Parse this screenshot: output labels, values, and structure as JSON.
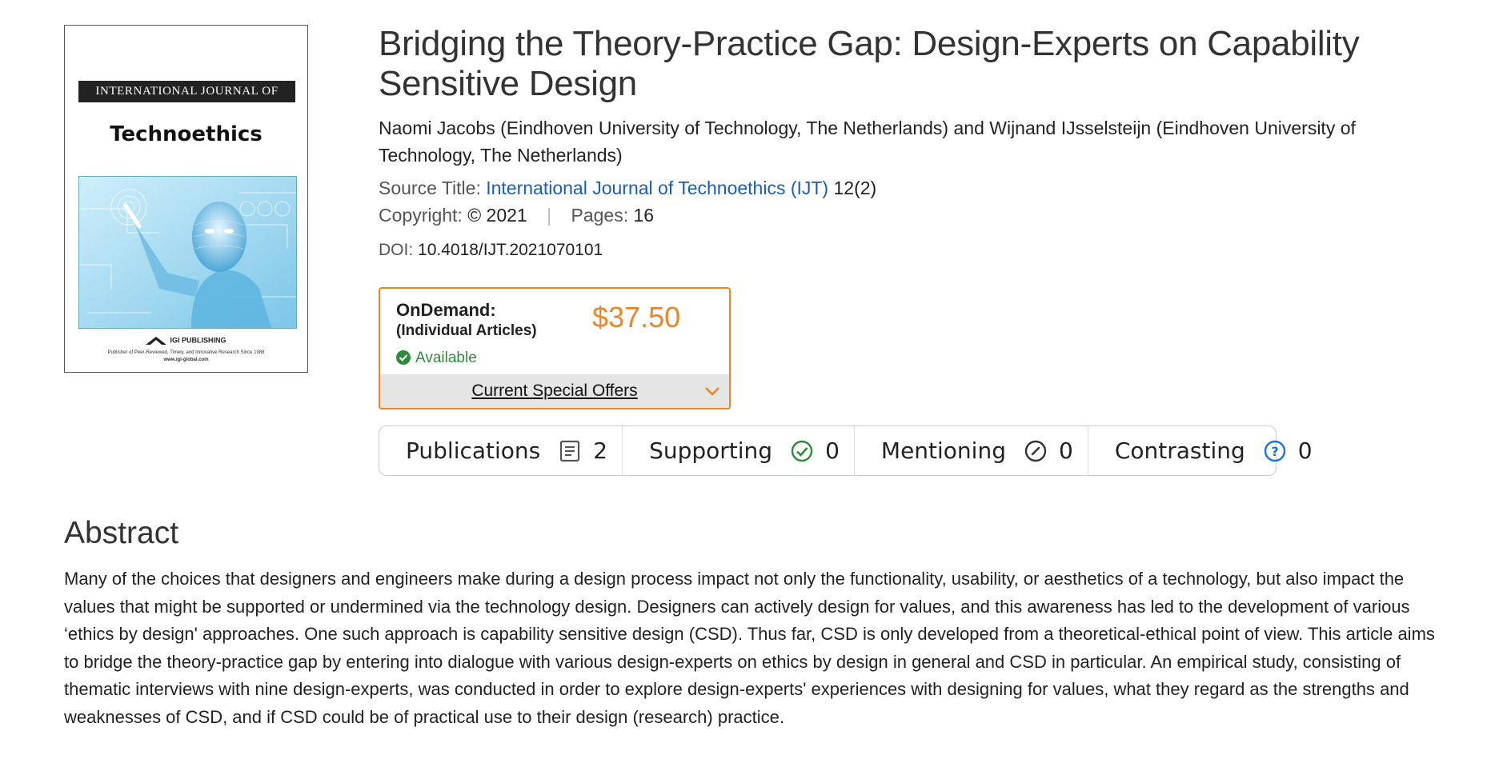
{
  "cover": {
    "journal_prefix": "INTERNATIONAL JOURNAL OF",
    "journal_name": "Technoethics",
    "publisher": "IGI PUBLISHING",
    "tagline": "Publisher of Peer-Reviewed, Timely, and Innovative Research Since 1988",
    "website": "www.igi-global.com"
  },
  "article": {
    "title": "Bridging the Theory-Practice Gap: Design-Experts on Capability Sensitive Design",
    "authors": "Naomi Jacobs (Eindhoven University of Technology, The Netherlands) and Wijnand IJsselsteijn (Eindhoven University of Technology, The Netherlands)",
    "source_label": "Source Title:",
    "source_title": "International Journal of Technoethics (IJT)",
    "source_issue": "12(2)",
    "copyright_label": "Copyright:",
    "copyright_value": "© 2021",
    "pages_label": "Pages:",
    "pages_value": "16",
    "doi_label": "DOI:",
    "doi_value": "10.4018/IJT.2021070101"
  },
  "purchase": {
    "type": "OnDemand:",
    "subtype": "(Individual Articles)",
    "price": "$37.50",
    "availability": "Available",
    "offers_label": "Current Special Offers"
  },
  "citations": [
    {
      "label": "Publications",
      "icon": "document-icon",
      "count": "2"
    },
    {
      "label": "Supporting",
      "icon": "check-circle-icon",
      "count": "0"
    },
    {
      "label": "Mentioning",
      "icon": "slash-circle-icon",
      "count": "0"
    },
    {
      "label": "Contrasting",
      "icon": "question-circle-icon",
      "count": "0"
    }
  ],
  "abstract": {
    "heading": "Abstract",
    "text": "Many of the choices that designers and engineers make during a design process impact not only the functionality, usability, or aesthetics of a technology, but also impact the values that might be supported or undermined via the technology design. Designers can actively design for values, and this awareness has led to the development of various ‘ethics by design' approaches. One such approach is capability sensitive design (CSD). Thus far, CSD is only developed from a theoretical-ethical point of view. This article aims to bridge the theory-practice gap by entering into dialogue with various design-experts on ethics by design in general and CSD in particular. An empirical study, consisting of thematic interviews with nine design-experts, was conducted in order to explore design-experts' experiences with designing for values, what they regard as the strengths and weaknesses of CSD, and if CSD could be of practical use to their design (research) practice."
  },
  "colors": {
    "accent_orange": "#e8872a",
    "link_blue": "#1a5fb4",
    "available_green": "#2e8b3d",
    "supporting_green": "#2e8b3d",
    "contrasting_blue": "#1a73e8"
  }
}
